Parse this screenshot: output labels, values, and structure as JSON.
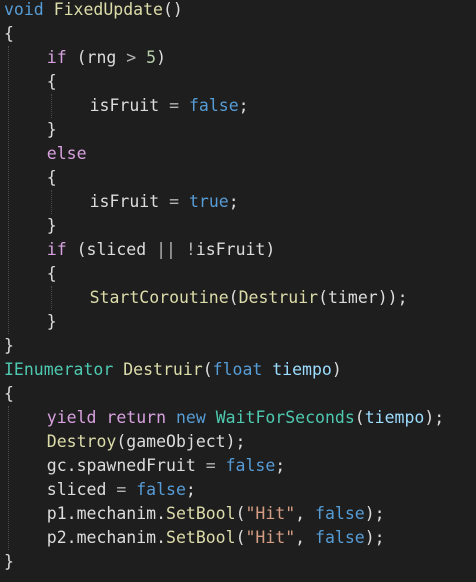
{
  "editor": {
    "theme": {
      "background": "#1e1e1e",
      "keyword": "#569cd6",
      "control": "#d8a0df",
      "type": "#4ec9b0",
      "method": "#dcdcaa",
      "parameter": "#9cdcfe",
      "string": "#d69d85",
      "number": "#b5cea8",
      "text": "#dcdcdc"
    },
    "lines": [
      {
        "indent": 0,
        "tokens": [
          [
            "kw",
            "void"
          ],
          [
            "id",
            " "
          ],
          [
            "fn",
            "FixedUpdate"
          ],
          [
            "id",
            "()"
          ]
        ]
      },
      {
        "indent": 0,
        "tokens": [
          [
            "id",
            "{"
          ]
        ]
      },
      {
        "indent": 1,
        "tokens": [
          [
            "ctl",
            "if"
          ],
          [
            "id",
            " (rng "
          ],
          [
            "op",
            ">"
          ],
          [
            "id",
            " "
          ],
          [
            "num",
            "5"
          ],
          [
            "id",
            ")"
          ]
        ]
      },
      {
        "indent": 1,
        "tokens": [
          [
            "id",
            "{"
          ]
        ]
      },
      {
        "indent": 2,
        "tokens": [
          [
            "id",
            "isFruit "
          ],
          [
            "op",
            "="
          ],
          [
            "id",
            " "
          ],
          [
            "kw",
            "false"
          ],
          [
            "id",
            ";"
          ]
        ]
      },
      {
        "indent": 1,
        "tokens": [
          [
            "id",
            "}"
          ]
        ]
      },
      {
        "indent": 1,
        "tokens": [
          [
            "ctl",
            "else"
          ]
        ]
      },
      {
        "indent": 1,
        "tokens": [
          [
            "id",
            "{"
          ]
        ]
      },
      {
        "indent": 2,
        "tokens": [
          [
            "id",
            "isFruit "
          ],
          [
            "op",
            "="
          ],
          [
            "id",
            " "
          ],
          [
            "kw",
            "true"
          ],
          [
            "id",
            ";"
          ]
        ]
      },
      {
        "indent": 1,
        "tokens": [
          [
            "id",
            "}"
          ]
        ]
      },
      {
        "indent": 1,
        "tokens": [
          [
            "ctl",
            "if"
          ],
          [
            "id",
            " (sliced "
          ],
          [
            "op",
            "||"
          ],
          [
            "id",
            " "
          ],
          [
            "op",
            "!"
          ],
          [
            "id",
            "isFruit)"
          ]
        ]
      },
      {
        "indent": 1,
        "tokens": [
          [
            "id",
            "{"
          ]
        ]
      },
      {
        "indent": 2,
        "tokens": [
          [
            "fn",
            "StartCoroutine"
          ],
          [
            "id",
            "("
          ],
          [
            "fn",
            "Destruir"
          ],
          [
            "id",
            "(timer));"
          ]
        ]
      },
      {
        "indent": 1,
        "tokens": [
          [
            "id",
            "}"
          ]
        ]
      },
      {
        "indent": 0,
        "tokens": [
          [
            "id",
            "}"
          ]
        ]
      },
      {
        "indent": 0,
        "tokens": [
          [
            "type",
            "IEnumerator"
          ],
          [
            "id",
            " "
          ],
          [
            "fn",
            "Destruir"
          ],
          [
            "id",
            "("
          ],
          [
            "kw",
            "float"
          ],
          [
            "id",
            " "
          ],
          [
            "par",
            "tiempo"
          ],
          [
            "id",
            ")"
          ]
        ]
      },
      {
        "indent": 0,
        "tokens": [
          [
            "id",
            "{"
          ]
        ]
      },
      {
        "indent": 1,
        "tokens": [
          [
            "ctl",
            "yield"
          ],
          [
            "id",
            " "
          ],
          [
            "ctl",
            "return"
          ],
          [
            "id",
            " "
          ],
          [
            "kw",
            "new"
          ],
          [
            "id",
            " "
          ],
          [
            "type",
            "WaitForSeconds"
          ],
          [
            "id",
            "("
          ],
          [
            "par",
            "tiempo"
          ],
          [
            "id",
            ");"
          ]
        ]
      },
      {
        "indent": 1,
        "tokens": [
          [
            "fn",
            "Destroy"
          ],
          [
            "id",
            "(gameObject);"
          ]
        ]
      },
      {
        "indent": 1,
        "tokens": [
          [
            "id",
            "gc.spawnedFruit "
          ],
          [
            "op",
            "="
          ],
          [
            "id",
            " "
          ],
          [
            "kw",
            "false"
          ],
          [
            "id",
            ";"
          ]
        ]
      },
      {
        "indent": 1,
        "tokens": [
          [
            "id",
            "sliced "
          ],
          [
            "op",
            "="
          ],
          [
            "id",
            " "
          ],
          [
            "kw",
            "false"
          ],
          [
            "id",
            ";"
          ]
        ]
      },
      {
        "indent": 1,
        "tokens": [
          [
            "id",
            "p1.mechanim."
          ],
          [
            "fn",
            "SetBool"
          ],
          [
            "id",
            "("
          ],
          [
            "str",
            "\"Hit\""
          ],
          [
            "id",
            ", "
          ],
          [
            "kw",
            "false"
          ],
          [
            "id",
            ");"
          ]
        ]
      },
      {
        "indent": 1,
        "tokens": [
          [
            "id",
            "p2.mechanim."
          ],
          [
            "fn",
            "SetBool"
          ],
          [
            "id",
            "("
          ],
          [
            "str",
            "\"Hit\""
          ],
          [
            "id",
            ", "
          ],
          [
            "kw",
            "false"
          ],
          [
            "id",
            ");"
          ]
        ]
      },
      {
        "indent": 0,
        "tokens": [
          [
            "id",
            "}"
          ]
        ]
      }
    ]
  }
}
